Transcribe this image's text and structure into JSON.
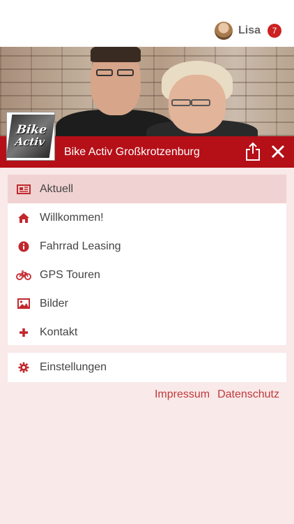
{
  "header": {
    "user_name": "Lisa",
    "notification_count": "7"
  },
  "banner": {
    "title": "Bike Activ Großkrotzenburg",
    "logo_text_line1": "Bike",
    "logo_text_line2": "Activ"
  },
  "menu": {
    "items": [
      {
        "label": "Aktuell",
        "icon": "newspaper-icon"
      },
      {
        "label": "Willkommen!",
        "icon": "home-icon"
      },
      {
        "label": "Fahrrad Leasing",
        "icon": "info-icon"
      },
      {
        "label": "GPS Touren",
        "icon": "bicycle-icon"
      },
      {
        "label": "Bilder",
        "icon": "image-icon"
      },
      {
        "label": "Kontakt",
        "icon": "plus-icon"
      }
    ],
    "active_index": 0
  },
  "settings": {
    "label": "Einstellungen",
    "icon": "gear-icon"
  },
  "footer": {
    "impressum": "Impressum",
    "datenschutz": "Datenschutz"
  },
  "colors": {
    "accent": "#b50f18",
    "icon": "#c1272d",
    "background": "#f9e9e9",
    "active_row": "#f1d2d2",
    "link": "#c0393b"
  }
}
